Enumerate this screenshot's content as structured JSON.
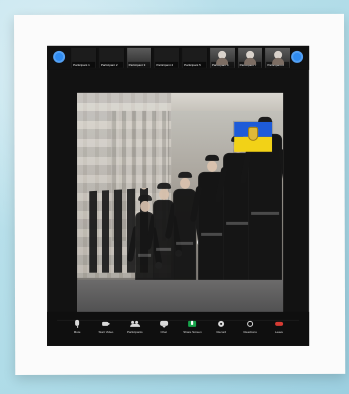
{
  "window": {
    "left_circle_icon": "circle-icon",
    "right_circle_icon": "circle-icon"
  },
  "participants": [
    {
      "name": "Participant 1"
    },
    {
      "name": "Participant 2"
    },
    {
      "name": "Participant 3"
    },
    {
      "name": "Participant 4"
    },
    {
      "name": "Participant 5"
    },
    {
      "name": "Participant 6"
    },
    {
      "name": "Participant 7"
    },
    {
      "name": "Participant 8"
    }
  ],
  "controls": [
    {
      "label": "Mute",
      "icon": "mic-icon"
    },
    {
      "label": "Start Video",
      "icon": "video-icon"
    },
    {
      "label": "Participants",
      "icon": "users-icon"
    },
    {
      "label": "Chat",
      "icon": "chat-icon"
    },
    {
      "label": "Share Screen",
      "icon": "share-icon"
    },
    {
      "label": "Record",
      "icon": "record-icon"
    },
    {
      "label": "Reactions",
      "icon": "reactions-icon"
    },
    {
      "label": "Leave",
      "icon": "leave-icon"
    }
  ],
  "colors": {
    "accent_blue": "#2f8bf0",
    "flag_blue": "#1e5bd8",
    "flag_yellow": "#f2d217",
    "share_green": "#16a34a",
    "leave_red": "#d63b33"
  }
}
